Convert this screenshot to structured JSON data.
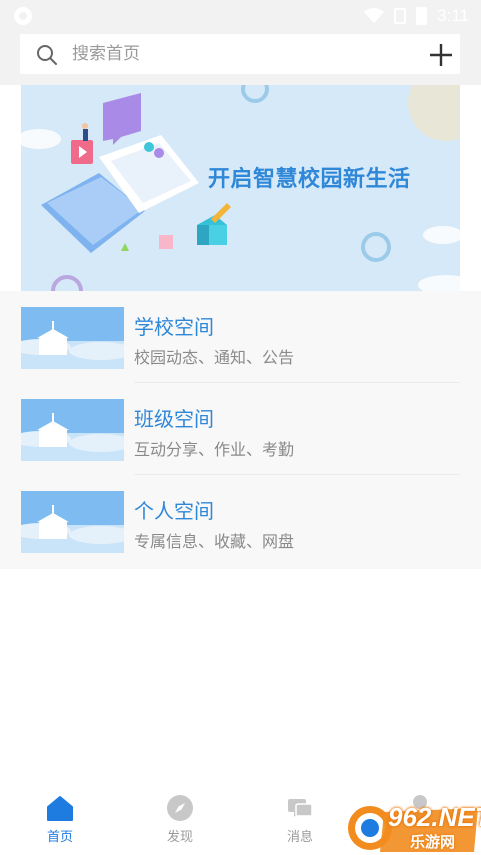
{
  "status_bar": {
    "time": "3:11"
  },
  "search": {
    "placeholder": "搜索首页"
  },
  "banner": {
    "title": "开启智慧校园新生活"
  },
  "spaces": [
    {
      "title": "学校空间",
      "subtitle": "校园动态、通知、公告"
    },
    {
      "title": "班级空间",
      "subtitle": "互动分享、作业、考勤"
    },
    {
      "title": "个人空间",
      "subtitle": "专属信息、收藏、网盘"
    }
  ],
  "nav": [
    {
      "label": "首页",
      "icon": "home-icon",
      "active": true
    },
    {
      "label": "发现",
      "icon": "compass-icon",
      "active": false
    },
    {
      "label": "消息",
      "icon": "message-icon",
      "active": false
    },
    {
      "label": "",
      "icon": "profile-icon",
      "active": false
    }
  ],
  "watermark": {
    "brand": "962.NET",
    "sub": "乐游网"
  },
  "colors": {
    "accent": "#2f87d8",
    "nav_active": "#1e7be0",
    "banner_bg": "#d6e9f8"
  }
}
